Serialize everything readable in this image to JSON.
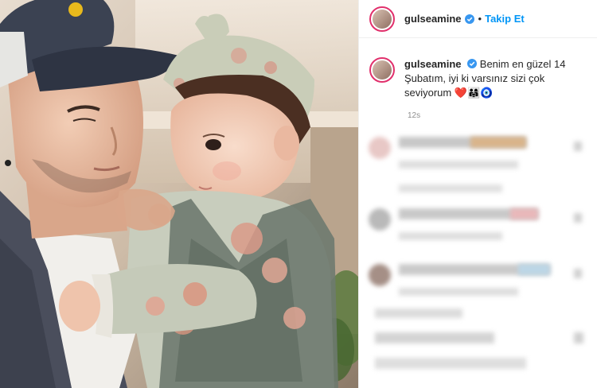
{
  "post": {
    "username": "gulseamine",
    "follow_label": "Takip Et",
    "dot": "•",
    "more": "···"
  },
  "caption": {
    "username": "gulseamine",
    "text": "Benim en güzel 14 Şubatım, iyi ki varsınız sizi çok seviyorum",
    "emojis": "❤️👨‍👩‍👧🧿",
    "time": "12s"
  },
  "colors": {
    "accent": "#0095f6",
    "verified": "#3897f0",
    "story_ring": "#e1306c"
  }
}
